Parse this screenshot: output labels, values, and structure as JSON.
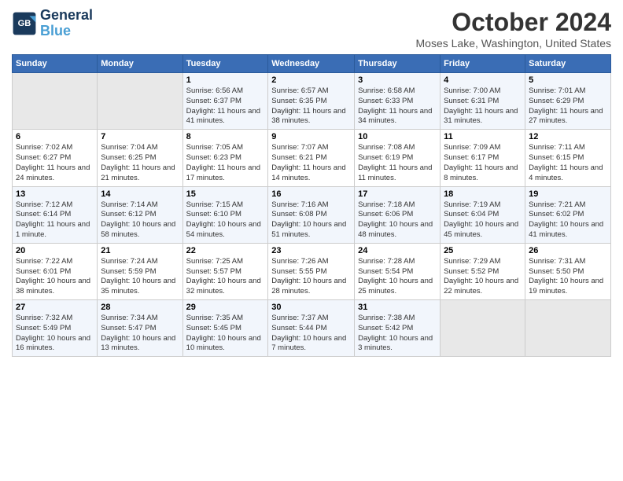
{
  "header": {
    "logo_line1": "General",
    "logo_line2": "Blue",
    "month": "October 2024",
    "location": "Moses Lake, Washington, United States"
  },
  "days_of_week": [
    "Sunday",
    "Monday",
    "Tuesday",
    "Wednesday",
    "Thursday",
    "Friday",
    "Saturday"
  ],
  "weeks": [
    [
      {
        "day": "",
        "empty": true
      },
      {
        "day": "",
        "empty": true
      },
      {
        "day": "1",
        "sunrise": "Sunrise: 6:56 AM",
        "sunset": "Sunset: 6:37 PM",
        "daylight": "Daylight: 11 hours and 41 minutes."
      },
      {
        "day": "2",
        "sunrise": "Sunrise: 6:57 AM",
        "sunset": "Sunset: 6:35 PM",
        "daylight": "Daylight: 11 hours and 38 minutes."
      },
      {
        "day": "3",
        "sunrise": "Sunrise: 6:58 AM",
        "sunset": "Sunset: 6:33 PM",
        "daylight": "Daylight: 11 hours and 34 minutes."
      },
      {
        "day": "4",
        "sunrise": "Sunrise: 7:00 AM",
        "sunset": "Sunset: 6:31 PM",
        "daylight": "Daylight: 11 hours and 31 minutes."
      },
      {
        "day": "5",
        "sunrise": "Sunrise: 7:01 AM",
        "sunset": "Sunset: 6:29 PM",
        "daylight": "Daylight: 11 hours and 27 minutes."
      }
    ],
    [
      {
        "day": "6",
        "sunrise": "Sunrise: 7:02 AM",
        "sunset": "Sunset: 6:27 PM",
        "daylight": "Daylight: 11 hours and 24 minutes."
      },
      {
        "day": "7",
        "sunrise": "Sunrise: 7:04 AM",
        "sunset": "Sunset: 6:25 PM",
        "daylight": "Daylight: 11 hours and 21 minutes."
      },
      {
        "day": "8",
        "sunrise": "Sunrise: 7:05 AM",
        "sunset": "Sunset: 6:23 PM",
        "daylight": "Daylight: 11 hours and 17 minutes."
      },
      {
        "day": "9",
        "sunrise": "Sunrise: 7:07 AM",
        "sunset": "Sunset: 6:21 PM",
        "daylight": "Daylight: 11 hours and 14 minutes."
      },
      {
        "day": "10",
        "sunrise": "Sunrise: 7:08 AM",
        "sunset": "Sunset: 6:19 PM",
        "daylight": "Daylight: 11 hours and 11 minutes."
      },
      {
        "day": "11",
        "sunrise": "Sunrise: 7:09 AM",
        "sunset": "Sunset: 6:17 PM",
        "daylight": "Daylight: 11 hours and 8 minutes."
      },
      {
        "day": "12",
        "sunrise": "Sunrise: 7:11 AM",
        "sunset": "Sunset: 6:15 PM",
        "daylight": "Daylight: 11 hours and 4 minutes."
      }
    ],
    [
      {
        "day": "13",
        "sunrise": "Sunrise: 7:12 AM",
        "sunset": "Sunset: 6:14 PM",
        "daylight": "Daylight: 11 hours and 1 minute."
      },
      {
        "day": "14",
        "sunrise": "Sunrise: 7:14 AM",
        "sunset": "Sunset: 6:12 PM",
        "daylight": "Daylight: 10 hours and 58 minutes."
      },
      {
        "day": "15",
        "sunrise": "Sunrise: 7:15 AM",
        "sunset": "Sunset: 6:10 PM",
        "daylight": "Daylight: 10 hours and 54 minutes."
      },
      {
        "day": "16",
        "sunrise": "Sunrise: 7:16 AM",
        "sunset": "Sunset: 6:08 PM",
        "daylight": "Daylight: 10 hours and 51 minutes."
      },
      {
        "day": "17",
        "sunrise": "Sunrise: 7:18 AM",
        "sunset": "Sunset: 6:06 PM",
        "daylight": "Daylight: 10 hours and 48 minutes."
      },
      {
        "day": "18",
        "sunrise": "Sunrise: 7:19 AM",
        "sunset": "Sunset: 6:04 PM",
        "daylight": "Daylight: 10 hours and 45 minutes."
      },
      {
        "day": "19",
        "sunrise": "Sunrise: 7:21 AM",
        "sunset": "Sunset: 6:02 PM",
        "daylight": "Daylight: 10 hours and 41 minutes."
      }
    ],
    [
      {
        "day": "20",
        "sunrise": "Sunrise: 7:22 AM",
        "sunset": "Sunset: 6:01 PM",
        "daylight": "Daylight: 10 hours and 38 minutes."
      },
      {
        "day": "21",
        "sunrise": "Sunrise: 7:24 AM",
        "sunset": "Sunset: 5:59 PM",
        "daylight": "Daylight: 10 hours and 35 minutes."
      },
      {
        "day": "22",
        "sunrise": "Sunrise: 7:25 AM",
        "sunset": "Sunset: 5:57 PM",
        "daylight": "Daylight: 10 hours and 32 minutes."
      },
      {
        "day": "23",
        "sunrise": "Sunrise: 7:26 AM",
        "sunset": "Sunset: 5:55 PM",
        "daylight": "Daylight: 10 hours and 28 minutes."
      },
      {
        "day": "24",
        "sunrise": "Sunrise: 7:28 AM",
        "sunset": "Sunset: 5:54 PM",
        "daylight": "Daylight: 10 hours and 25 minutes."
      },
      {
        "day": "25",
        "sunrise": "Sunrise: 7:29 AM",
        "sunset": "Sunset: 5:52 PM",
        "daylight": "Daylight: 10 hours and 22 minutes."
      },
      {
        "day": "26",
        "sunrise": "Sunrise: 7:31 AM",
        "sunset": "Sunset: 5:50 PM",
        "daylight": "Daylight: 10 hours and 19 minutes."
      }
    ],
    [
      {
        "day": "27",
        "sunrise": "Sunrise: 7:32 AM",
        "sunset": "Sunset: 5:49 PM",
        "daylight": "Daylight: 10 hours and 16 minutes."
      },
      {
        "day": "28",
        "sunrise": "Sunrise: 7:34 AM",
        "sunset": "Sunset: 5:47 PM",
        "daylight": "Daylight: 10 hours and 13 minutes."
      },
      {
        "day": "29",
        "sunrise": "Sunrise: 7:35 AM",
        "sunset": "Sunset: 5:45 PM",
        "daylight": "Daylight: 10 hours and 10 minutes."
      },
      {
        "day": "30",
        "sunrise": "Sunrise: 7:37 AM",
        "sunset": "Sunset: 5:44 PM",
        "daylight": "Daylight: 10 hours and 7 minutes."
      },
      {
        "day": "31",
        "sunrise": "Sunrise: 7:38 AM",
        "sunset": "Sunset: 5:42 PM",
        "daylight": "Daylight: 10 hours and 3 minutes."
      },
      {
        "day": "",
        "empty": true
      },
      {
        "day": "",
        "empty": true
      }
    ]
  ]
}
